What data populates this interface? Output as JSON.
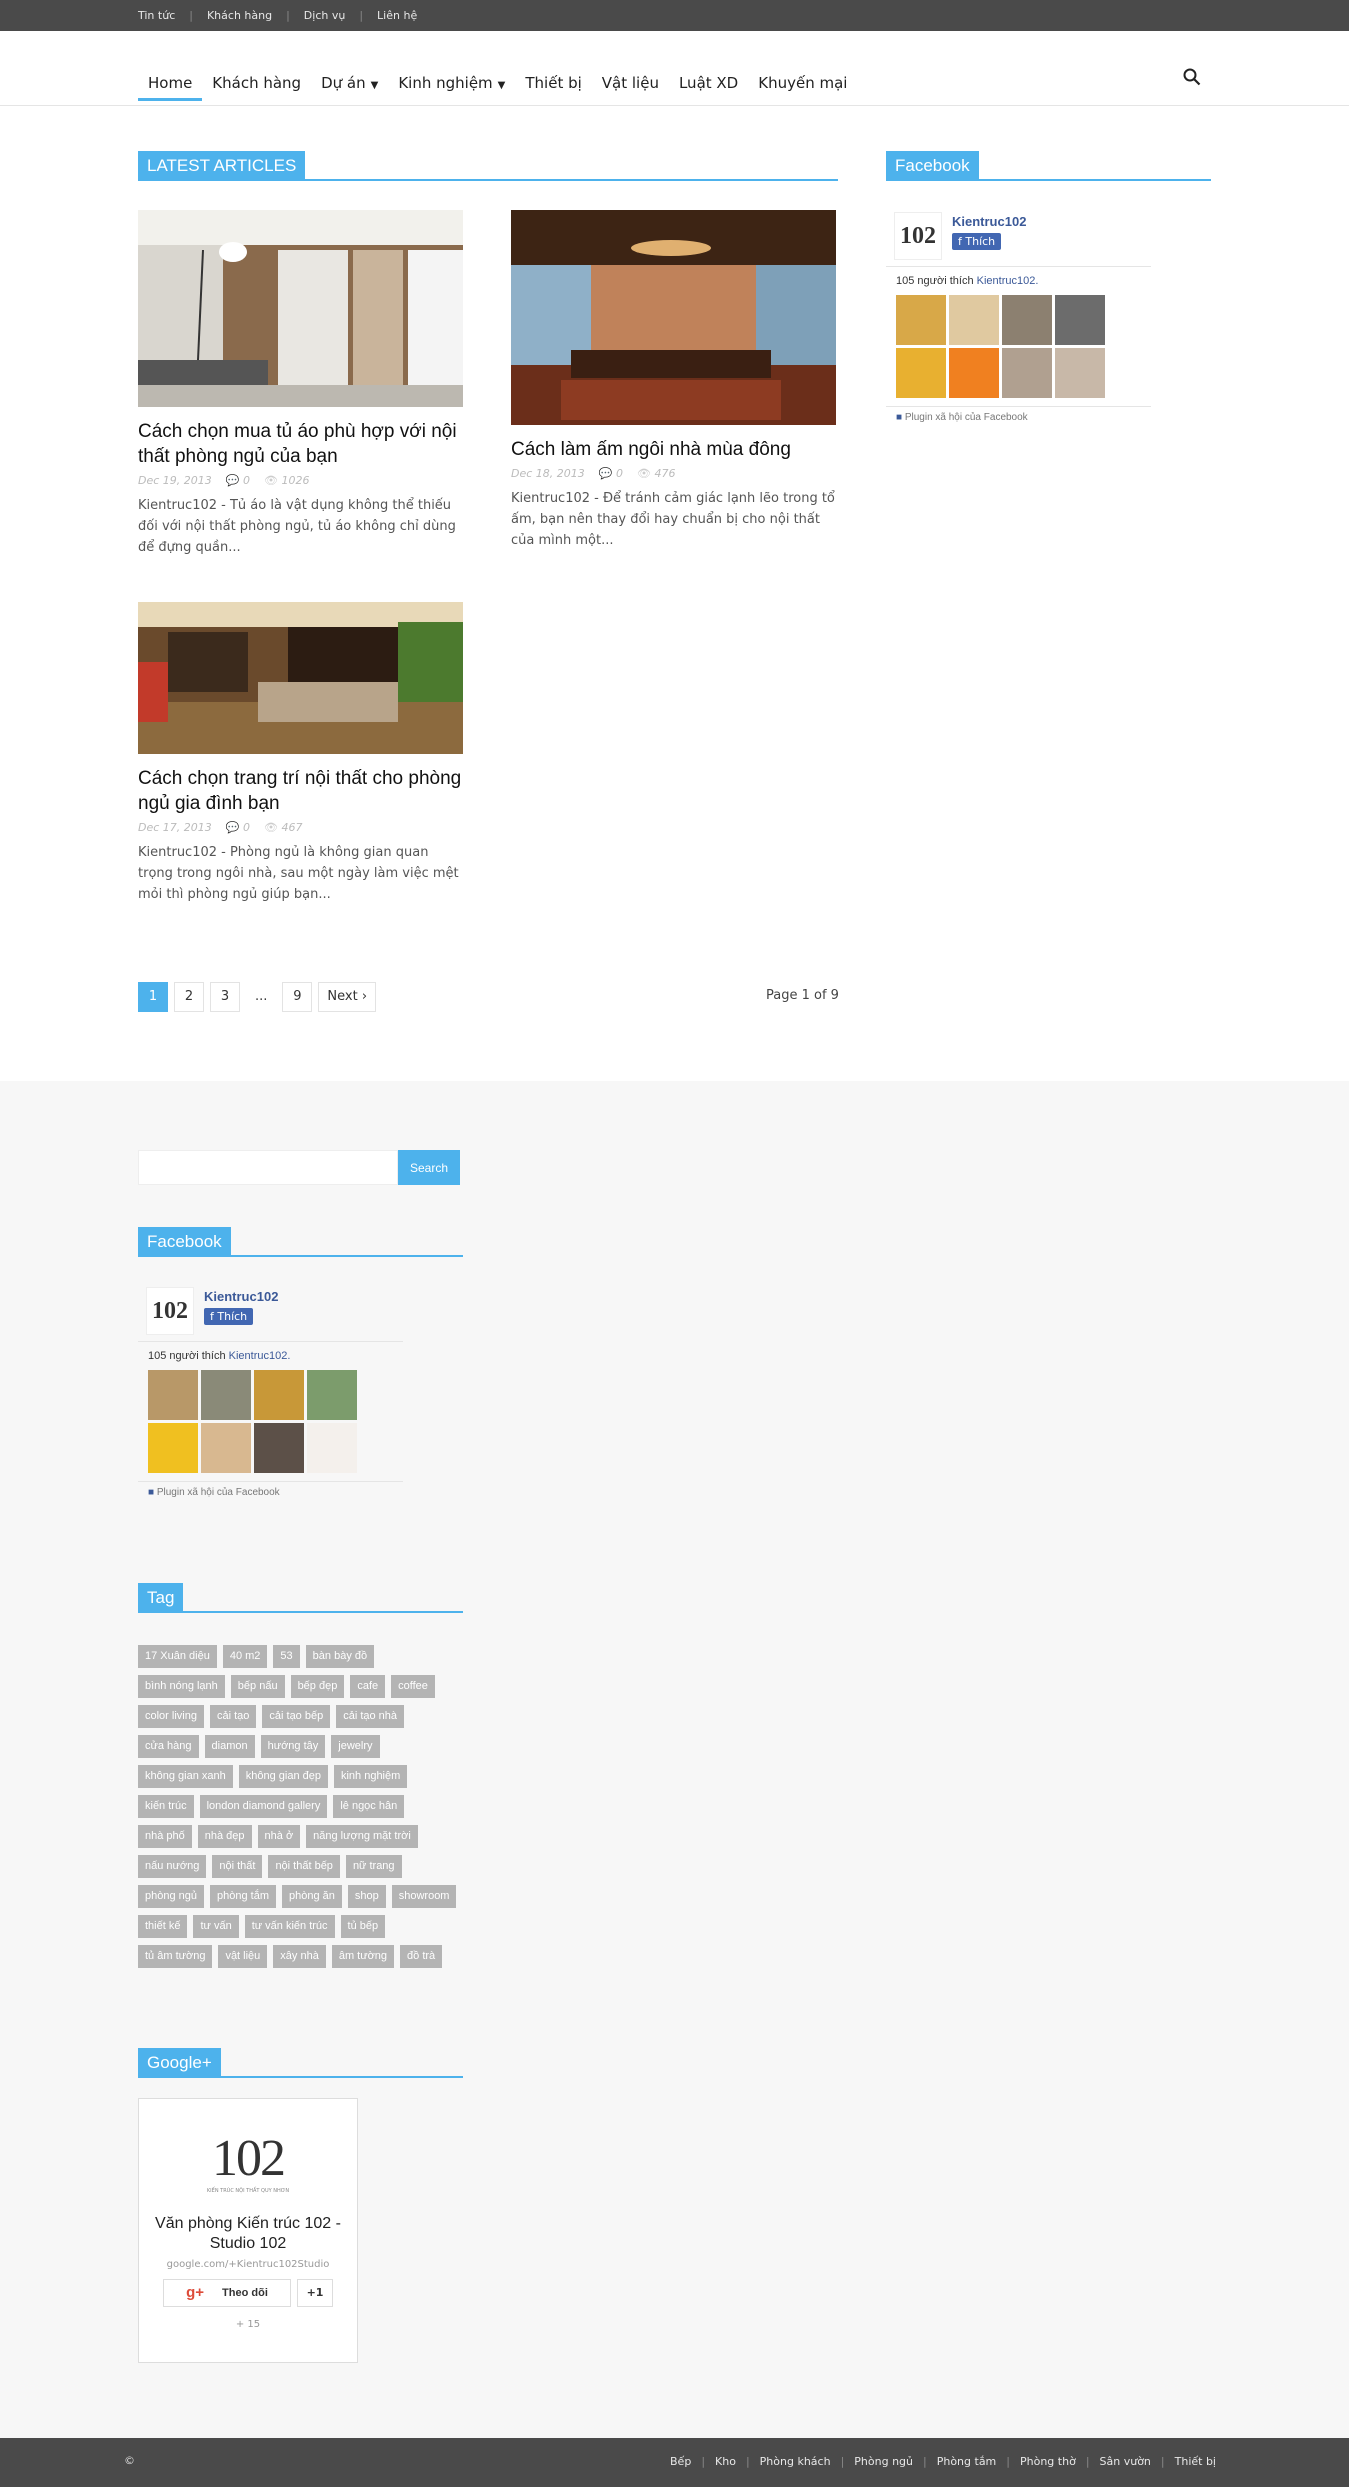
{
  "topbar": {
    "links": [
      "Tin tức",
      "Khách hàng",
      "Dịch vụ",
      "Liên hệ"
    ]
  },
  "nav": {
    "items": [
      {
        "label": "Home",
        "active": true
      },
      {
        "label": "Khách hàng"
      },
      {
        "label": "Dự án",
        "dropdown": true
      },
      {
        "label": "Kinh nghiệm",
        "dropdown": true
      },
      {
        "label": "Thiết bị"
      },
      {
        "label": "Vật liệu"
      },
      {
        "label": "Luật XD"
      },
      {
        "label": "Khuyến mại"
      }
    ],
    "search_icon": "search-icon"
  },
  "latest": {
    "title": "LATEST ARTICLES",
    "articles": [
      {
        "title": "Cách chọn mua tủ áo phù hợp với nội thất phòng ngủ của bạn",
        "date": "Dec 19, 2013",
        "comments": "0",
        "views": "1026",
        "excerpt": "Kientruc102 - Tủ áo là vật dụng không thể thiếu đối với nội thất phòng ngủ, tủ áo không chỉ dùng để đựng quần..."
      },
      {
        "title": "Cách làm ấm ngôi nhà mùa đông",
        "date": "Dec 18, 2013",
        "comments": "0",
        "views": "476",
        "excerpt": "Kientruc102 - Để tránh cảm giác lạnh lẽo trong tổ ấm, bạn nên thay đổi hay chuẩn bị cho nội thất của mình một..."
      },
      {
        "title": "Cách chọn trang trí nội thất cho phòng ngủ gia đình bạn",
        "date": "Dec 17, 2013",
        "comments": "0",
        "views": "467",
        "excerpt": "Kientruc102 - Phòng ngủ là không gian quan trọng trong ngôi nhà, sau một ngày làm việc mệt mỏi thì phòng ngủ giúp bạn..."
      }
    ]
  },
  "pagination": {
    "pages": [
      "1",
      "2",
      "3",
      "...",
      "9"
    ],
    "next": "Next",
    "current": "1",
    "info": "Page 1 of 9"
  },
  "facebook": {
    "title": "Facebook",
    "page_name": "Kientruc102",
    "like": "Thích",
    "count_text": "105 người thích",
    "count_link": "Kientruc102.",
    "footer": "Plugin xã hội của Facebook",
    "logo_text": "102"
  },
  "search": {
    "button": "Search",
    "placeholder": ""
  },
  "tag_block": {
    "title": "Tag",
    "tags": [
      "17 Xuân diệu",
      "40 m2",
      "53",
      "bàn bày đồ",
      "bình nóng lạnh",
      "bếp nấu",
      "bếp đẹp",
      "cafe",
      "coffee",
      "color living",
      "cải tạo",
      "cải tạo bếp",
      "cải tạo nhà",
      "cửa hàng",
      "diamon",
      "hướng tây",
      "jewelry",
      "không gian xanh",
      "không gian đẹp",
      "kinh nghiệm",
      "kiến trúc",
      "london diamond gallery",
      "lê ngọc hân",
      "nhà phố",
      "nhà đẹp",
      "nhà ở",
      "năng lượng mặt trời",
      "nấu nướng",
      "nội thất",
      "nội thất bếp",
      "nữ trang",
      "phòng ngủ",
      "phòng tắm",
      "phòng ăn",
      "shop",
      "showroom",
      "thiết kế",
      "tư vấn",
      "tư vấn kiến trúc",
      "tủ bếp",
      "tủ âm tường",
      "vật liệu",
      "xây nhà",
      "âm tường",
      "đồ trà"
    ]
  },
  "gplus": {
    "title": "Google+",
    "logo": "102",
    "logo_sub": "KIẾN TRÚC NỘI THẤT QUY NHƠN",
    "name": "Văn phòng Kiến trúc 102 - Studio 102",
    "url": "google.com/+Kientruc102Studio",
    "follow": "Theo dõi",
    "plus_one": "+1",
    "count": "+ 15"
  },
  "footer": {
    "copyright": "©",
    "links": [
      "Bếp",
      "Kho",
      "Phòng khách",
      "Phòng ngủ",
      "Phòng tắm",
      "Phòng thờ",
      "Sân vườn",
      "Thiết bị"
    ]
  },
  "colors": {
    "accent": "#4db2ec",
    "topbar": "#4a4a4a",
    "tag": "#b4b4b4"
  }
}
